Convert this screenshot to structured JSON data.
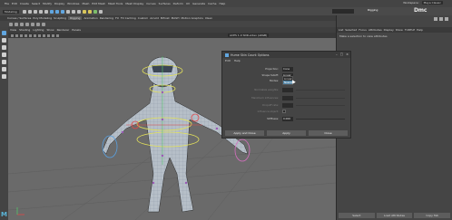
{
  "menubar": {
    "items": [
      "File",
      "Edit",
      "Create",
      "Select",
      "Modify",
      "Display",
      "Windows",
      "Mesh",
      "Edit Mesh",
      "Mesh Tools",
      "Mesh Display",
      "Curves",
      "Surfaces",
      "Deform",
      "UV",
      "Generate",
      "Cache",
      "Help"
    ],
    "workspace_label": "Workspace:",
    "workspace_value": "Maya Classic"
  },
  "shelf": {
    "mode": "Modeling",
    "live_selector": "",
    "user": "Rigging",
    "logo": "Dmc"
  },
  "shelf_tabs": [
    "Curves / Surfaces",
    "Poly Modeling",
    "Sculpting",
    "Rigging",
    "Animation",
    "Rendering",
    "FX",
    "FX Caching",
    "Custom",
    "Arnold",
    "Bifrost",
    "MASH",
    "Motion Graphics",
    "XGen"
  ],
  "active_shelf_tab": "Rigging",
  "viewport": {
    "menu": [
      "View",
      "Shading",
      "Lighting",
      "Show",
      "Renderer",
      "Panels"
    ],
    "camera": "ACES 1.0 SDR-video (sRGB)",
    "stats": ""
  },
  "right_panel": {
    "tabs": [
      "List",
      "Selected",
      "Focus",
      "Attributes",
      "Display",
      "Show",
      "TURTLE",
      "Help"
    ],
    "message": "Make a selection to view attributes",
    "bottom_buttons": [
      "Select",
      "Load Attributes",
      "Copy Tab"
    ]
  },
  "dialog": {
    "title": "Hume Skin Count Options",
    "menu": [
      "Edit",
      "Help"
    ],
    "rows": [
      {
        "label": "Projection:",
        "value": "Cone"
      },
      {
        "label": "Shape falloff:",
        "value": "Linear"
      },
      {
        "label": "Modes:",
        "value": "Nearest"
      },
      {
        "label": "Normalize weights:",
        "value": "",
        "dim": true
      },
      {
        "label": "Maximum influences:",
        "value": "",
        "dim": true
      },
      {
        "label": "Dropoff rate:",
        "value": "",
        "dim": true
      },
      {
        "label": "Influence object:",
        "value": "",
        "dim": true
      },
      {
        "label": "Stiffness:",
        "value": "0.000"
      }
    ],
    "dropdown_options": [
      "Linear",
      "Nearest"
    ],
    "buttons": [
      "Apply and Close",
      "Apply",
      "Close"
    ]
  },
  "colors": {
    "accent": "#61a6e0",
    "viewport_bg": "#6a6a6a",
    "highlight": "#5285a6"
  }
}
